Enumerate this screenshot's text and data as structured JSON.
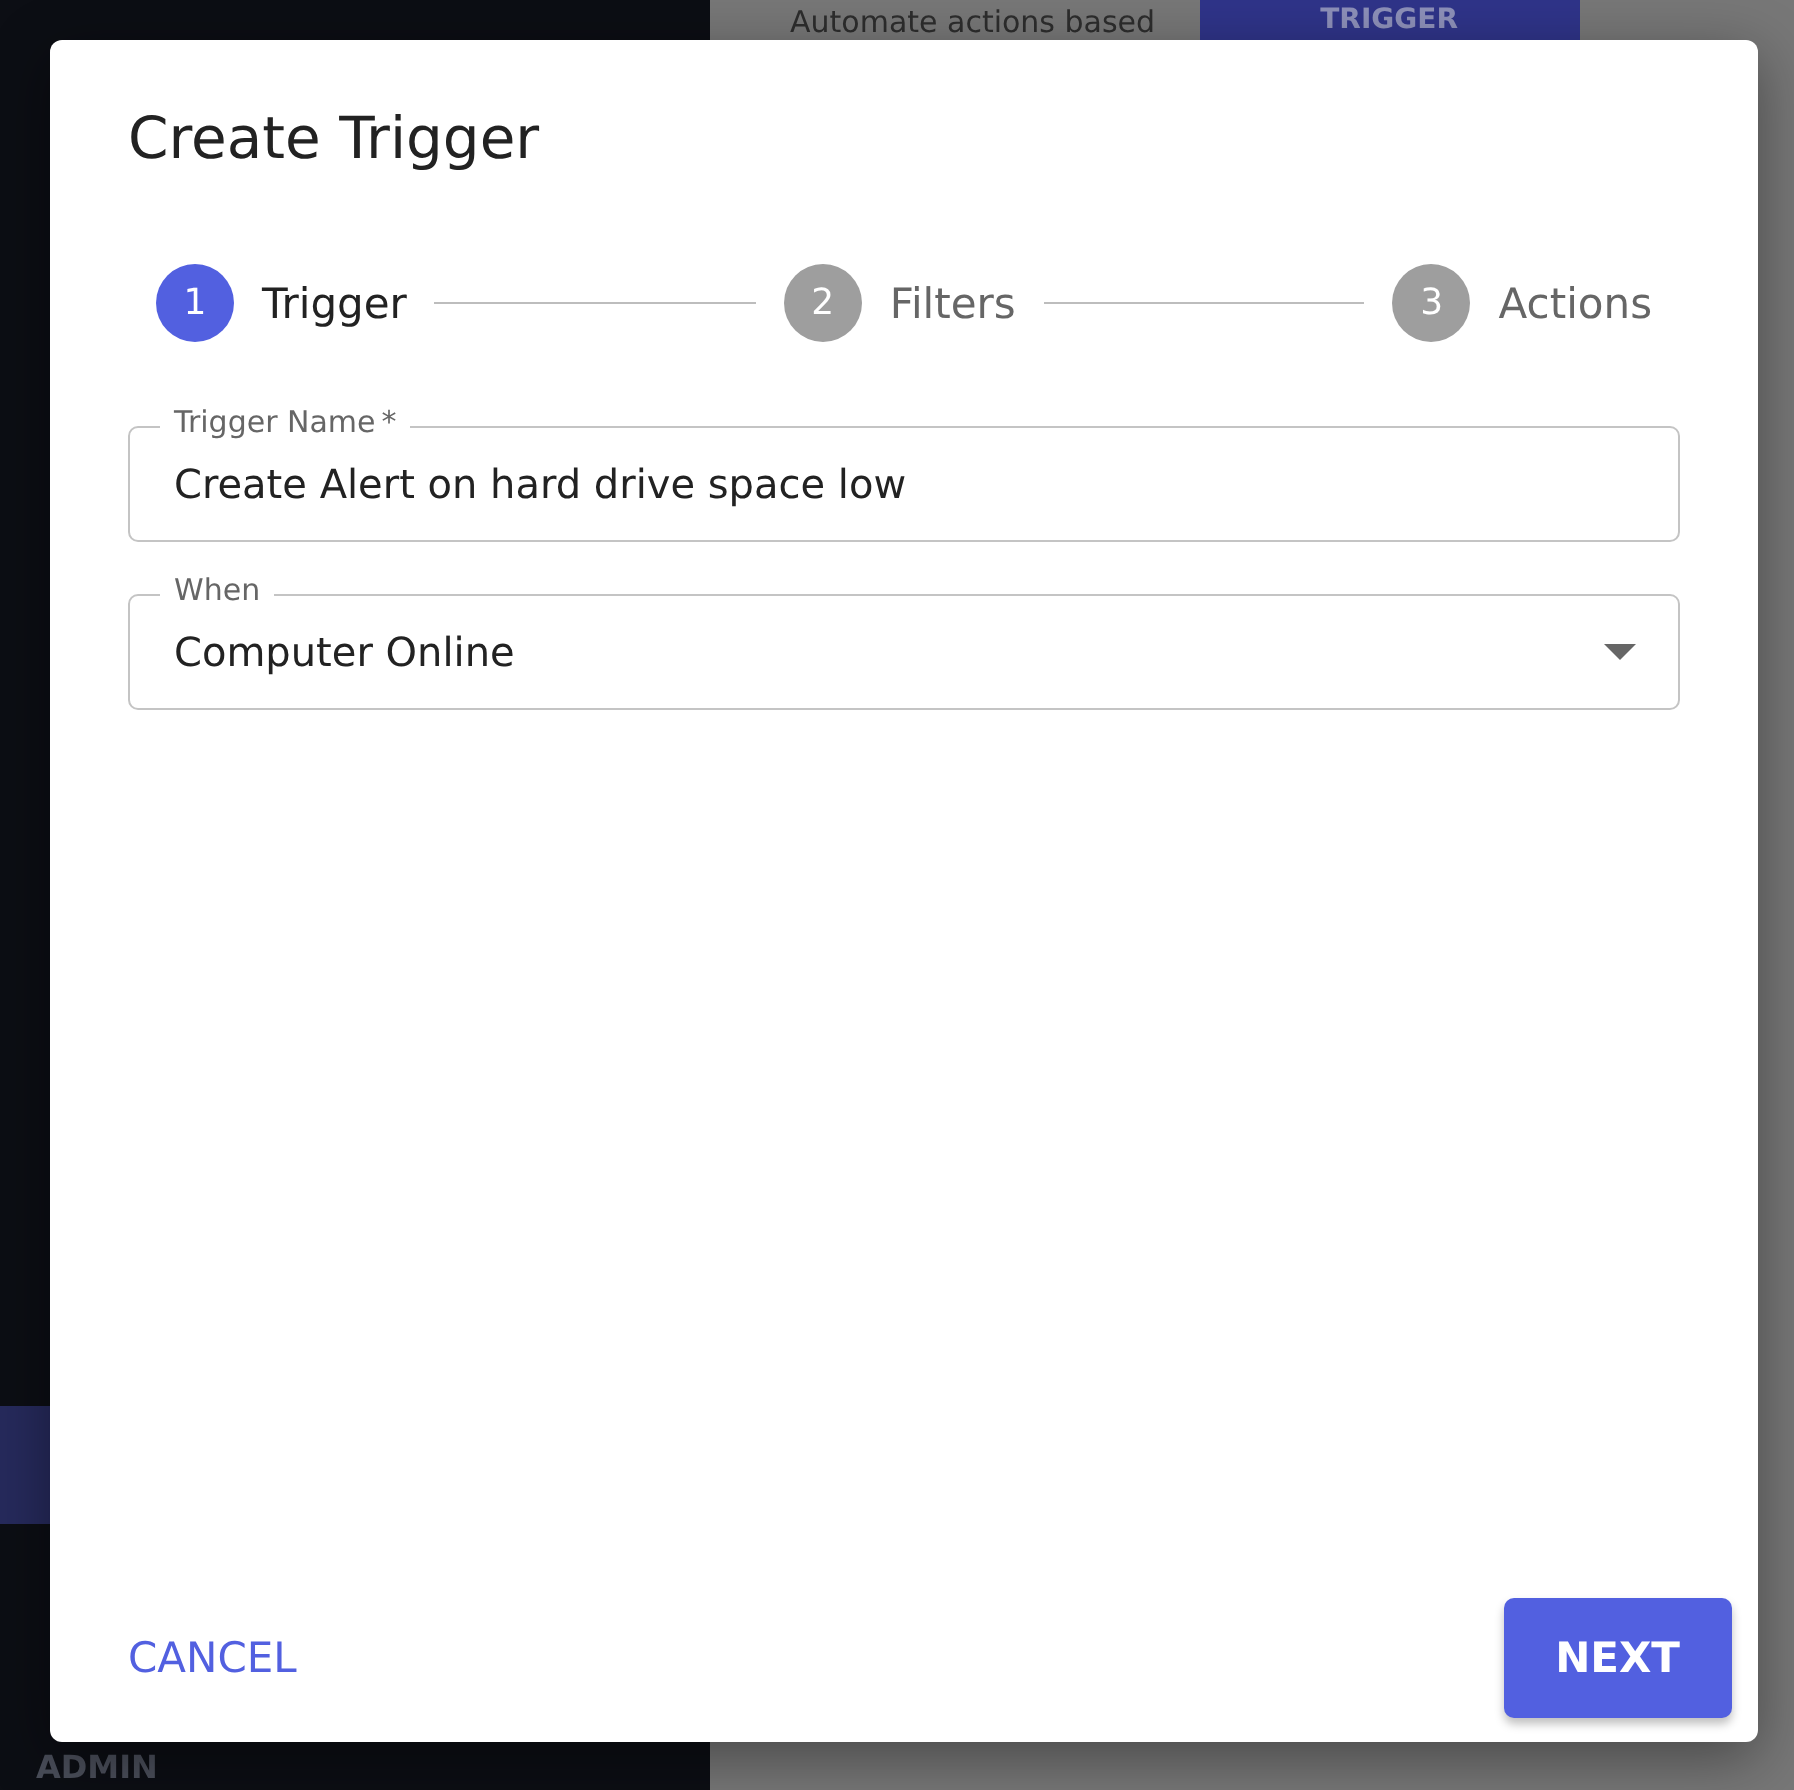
{
  "background": {
    "header_text": "Automate actions based",
    "header_button": "TRIGGER",
    "sidebar_section": "ADMIN"
  },
  "dialog": {
    "title": "Create Trigger",
    "steps": [
      {
        "number": "1",
        "label": "Trigger",
        "selected": true
      },
      {
        "number": "2",
        "label": "Filters",
        "selected": false
      },
      {
        "number": "3",
        "label": "Actions",
        "selected": false
      }
    ],
    "fields": [
      {
        "kind": "text",
        "label": "Trigger Name",
        "required": true,
        "required_mark": "*",
        "value": "Create Alert on hard drive space low"
      },
      {
        "kind": "select",
        "label": "When",
        "required": false,
        "value": "Computer Online"
      }
    ],
    "buttons": [
      {
        "kind": "text",
        "label": "CANCEL"
      },
      {
        "kind": "contained",
        "label": "NEXT"
      }
    ]
  }
}
